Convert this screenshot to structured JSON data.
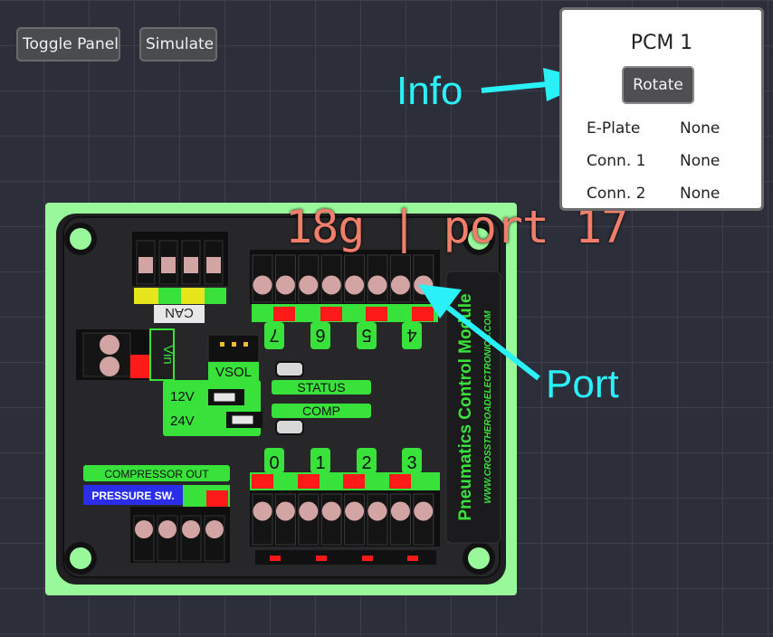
{
  "toolbar": {
    "toggle_panel_label": "Toggle Panel",
    "simulate_label": "Simulate"
  },
  "info_panel": {
    "title": "PCM 1",
    "rotate_label": "Rotate",
    "rows": [
      {
        "key": "E-Plate",
        "value": "None"
      },
      {
        "key": "Conn. 1",
        "value": "None"
      },
      {
        "key": "Conn. 2",
        "value": "None"
      }
    ]
  },
  "annotations": {
    "info": "Info",
    "port": "Port"
  },
  "port_hover_label": "18g | port 17",
  "pcm": {
    "can_label": "CAN",
    "vin_label": "Vin",
    "vsol_label": "VSOL",
    "v12_label": "12V",
    "v24_label": "24V",
    "status_label": "STATUS",
    "comp_label": "COMP",
    "compressor_out_label": "COMPRESSOR OUT",
    "pressure_sw_label": "PRESSURE SW.",
    "top_channels": [
      "7",
      "6",
      "5",
      "4"
    ],
    "bottom_channels": [
      "0",
      "1",
      "2",
      "3"
    ],
    "side_title": "Pneumatics Control Module",
    "side_url": "WWW.CROSSTHEROADELECTRONICS.COM"
  },
  "colors": {
    "board_outline": "#98f89a",
    "board_body": "#1f1f21",
    "accent_green": "#39e13b",
    "terminal_pink": "#d3a4a4",
    "red_pad": "#ff1a1a",
    "annotation_cyan": "#2af1f7",
    "port_label": "#f07e6b"
  }
}
